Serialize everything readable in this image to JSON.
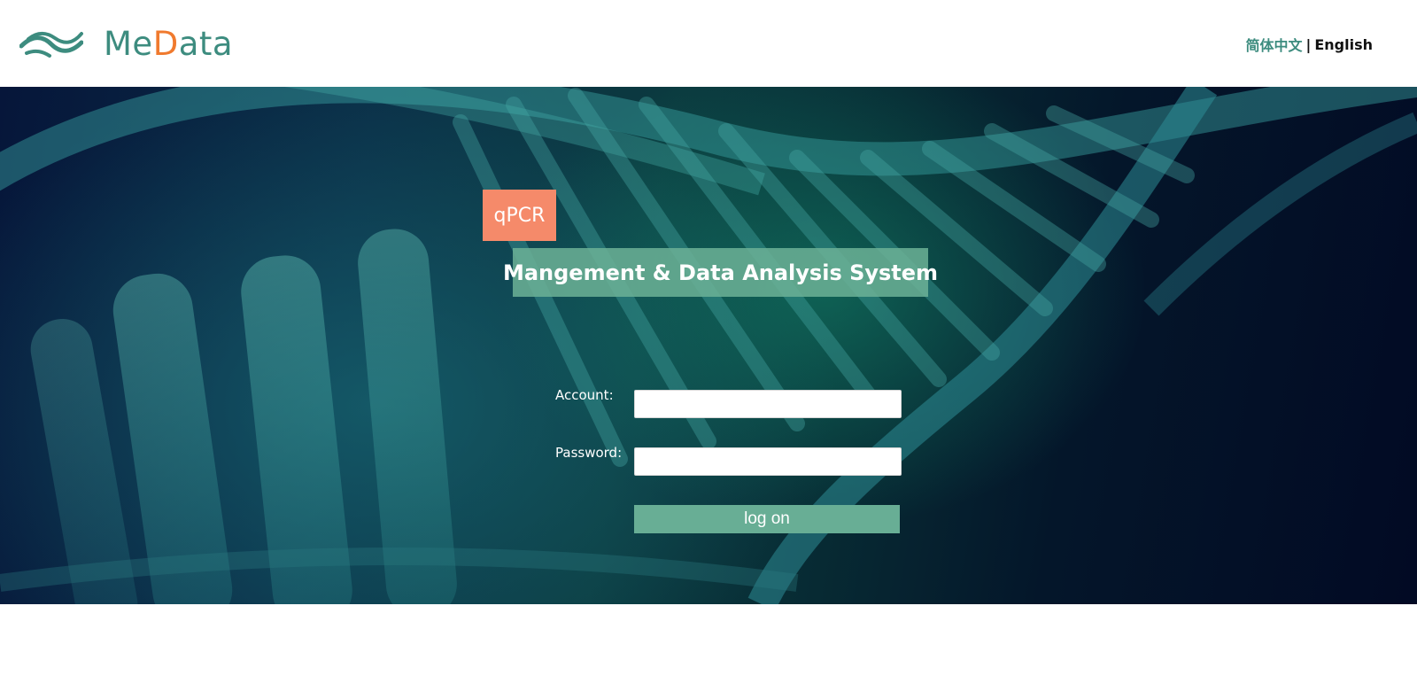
{
  "header": {
    "brand": {
      "part1": "Me",
      "part2": "D",
      "part3": "ata"
    },
    "language": {
      "chinese": "简体中文",
      "separator": "|",
      "english": "English"
    },
    "colors": {
      "brand_green": "#3d8c7f",
      "brand_orange": "#f07a2e"
    }
  },
  "banner": {
    "tag": "qPCR",
    "title": "Mangement & Data Analysis System",
    "colors": {
      "tag_bg": "#f58a6a",
      "title_bg": "#6cb296"
    }
  },
  "login": {
    "account_label": "Account:",
    "account_value": "",
    "password_label": "Password:",
    "password_value": "",
    "submit_label": "log on",
    "colors": {
      "button_bg": "#68ae95"
    }
  }
}
